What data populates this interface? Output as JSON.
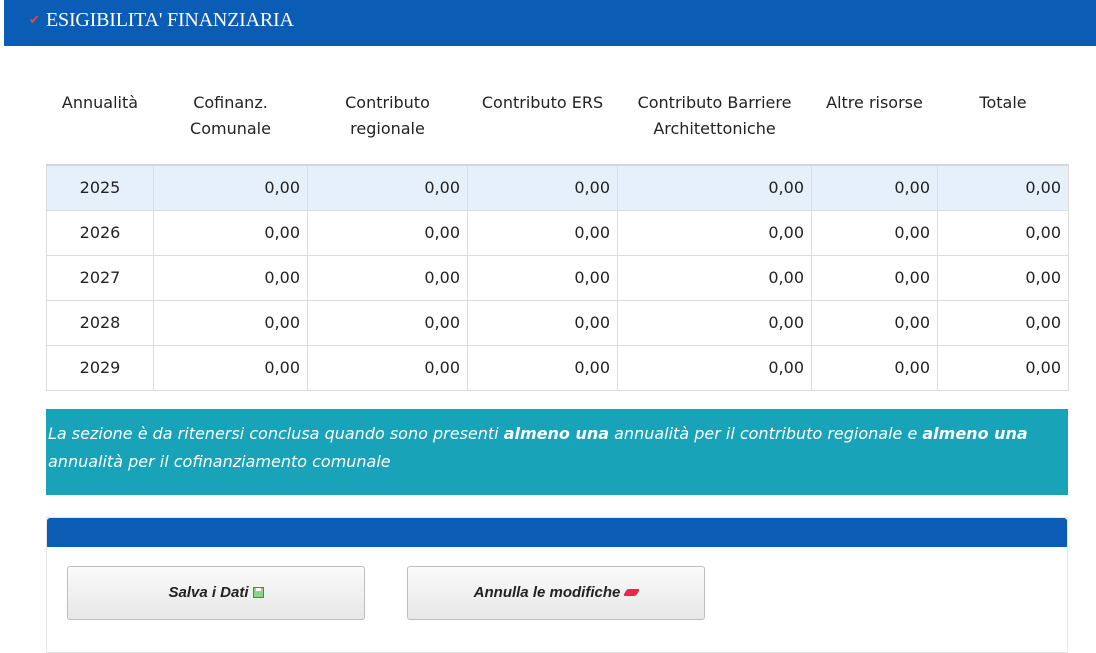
{
  "section": {
    "title": "ESIGIBILITA' FINANZIARIA",
    "check_icon": "check-icon",
    "color": "#0b5cb5"
  },
  "table": {
    "headers": [
      "Annualità",
      "Cofinanz. Comunale",
      "Contributo regionale",
      "Contributo ERS",
      "Contributo Barriere Architettoniche",
      "Altre risorse",
      "Totale"
    ],
    "rows": [
      {
        "year": "2025",
        "cofinanz": "0,00",
        "regionale": "0,00",
        "ers": "0,00",
        "barriere": "0,00",
        "altre": "0,00",
        "totale": "0,00"
      },
      {
        "year": "2026",
        "cofinanz": "0,00",
        "regionale": "0,00",
        "ers": "0,00",
        "barriere": "0,00",
        "altre": "0,00",
        "totale": "0,00"
      },
      {
        "year": "2027",
        "cofinanz": "0,00",
        "regionale": "0,00",
        "ers": "0,00",
        "barriere": "0,00",
        "altre": "0,00",
        "totale": "0,00"
      },
      {
        "year": "2028",
        "cofinanz": "0,00",
        "regionale": "0,00",
        "ers": "0,00",
        "barriere": "0,00",
        "altre": "0,00",
        "totale": "0,00"
      },
      {
        "year": "2029",
        "cofinanz": "0,00",
        "regionale": "0,00",
        "ers": "0,00",
        "barriere": "0,00",
        "altre": "0,00",
        "totale": "0,00"
      }
    ]
  },
  "notice": {
    "part1": "La sezione è da ritenersi conclusa quando sono presenti ",
    "bold1": "almeno una",
    "part2": " annualità per il contributo regionale e ",
    "bold2": "almeno una",
    "part3": " annualità per il cofinanziamento comunale",
    "color": "#18a3b8"
  },
  "actions": {
    "save_label": "Salva i Dati",
    "save_icon": "save-icon",
    "cancel_label": "Annulla le modifiche",
    "cancel_icon": "eraser-icon"
  }
}
